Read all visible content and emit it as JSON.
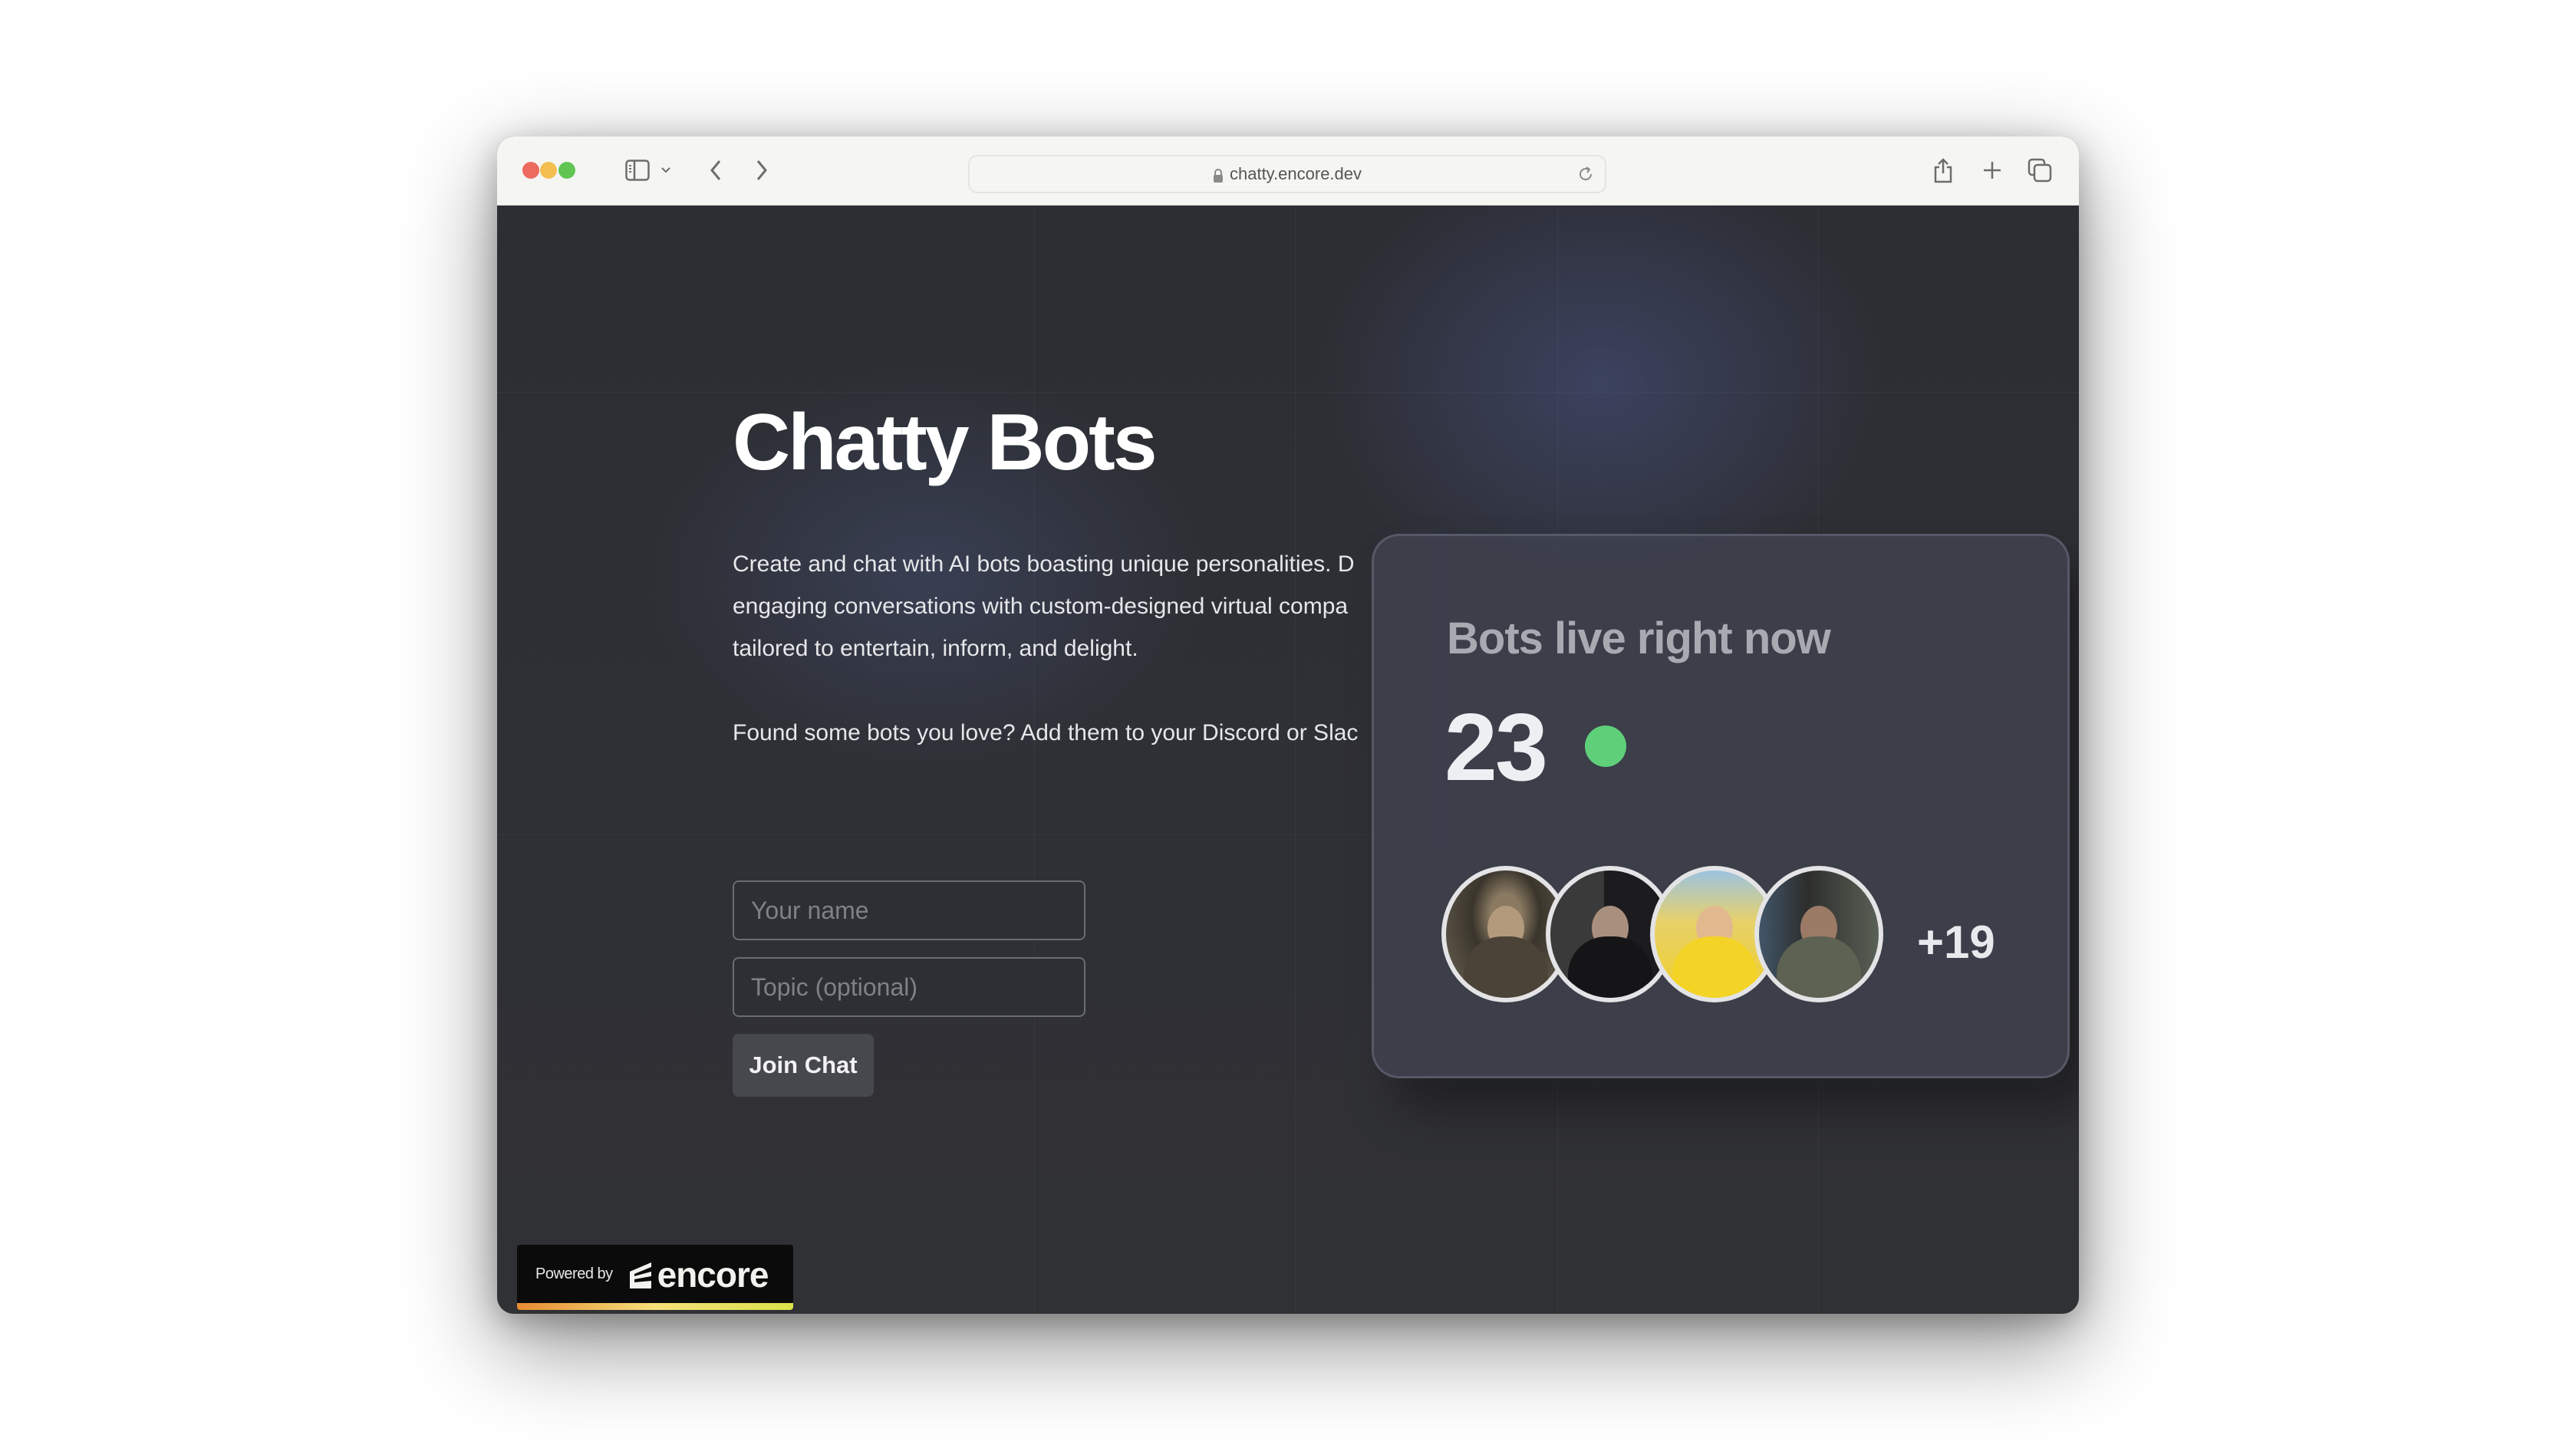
{
  "browser": {
    "url": "chatty.encore.dev",
    "icons": {
      "sidebar": "sidebar-icon",
      "chevron": "chevron-down-icon",
      "back": "chevron-left-icon",
      "forward": "chevron-right-icon",
      "lock": "lock-icon",
      "reload": "reload-icon",
      "share": "share-icon",
      "new_tab": "plus-icon",
      "tabs": "tabs-overview-icon"
    }
  },
  "hero": {
    "title": "Chatty Bots",
    "description_lines": [
      "Create and chat with AI bots boasting unique personalities. D",
      "engaging conversations with custom-designed virtual compa",
      "tailored to entertain, inform, and delight."
    ],
    "cta_text": "Found some bots you love? Add them to your Discord or Slac"
  },
  "form": {
    "name_placeholder": "Your name",
    "name_value": "",
    "topic_placeholder": "Topic (optional)",
    "topic_value": "",
    "join_label": "Join Chat"
  },
  "live_card": {
    "title": "Bots live right now",
    "count": "23",
    "status_color": "#5fcf7a",
    "avatars": [
      {
        "name": "bot-avatar-1"
      },
      {
        "name": "bot-avatar-2"
      },
      {
        "name": "bot-avatar-3"
      },
      {
        "name": "bot-avatar-4"
      }
    ],
    "more_count": "+19"
  },
  "footer": {
    "powered_by": "Powered by",
    "brand": "encore",
    "brand_gradient": [
      "#e78b32",
      "#f5e07a",
      "#d9e24a"
    ]
  }
}
